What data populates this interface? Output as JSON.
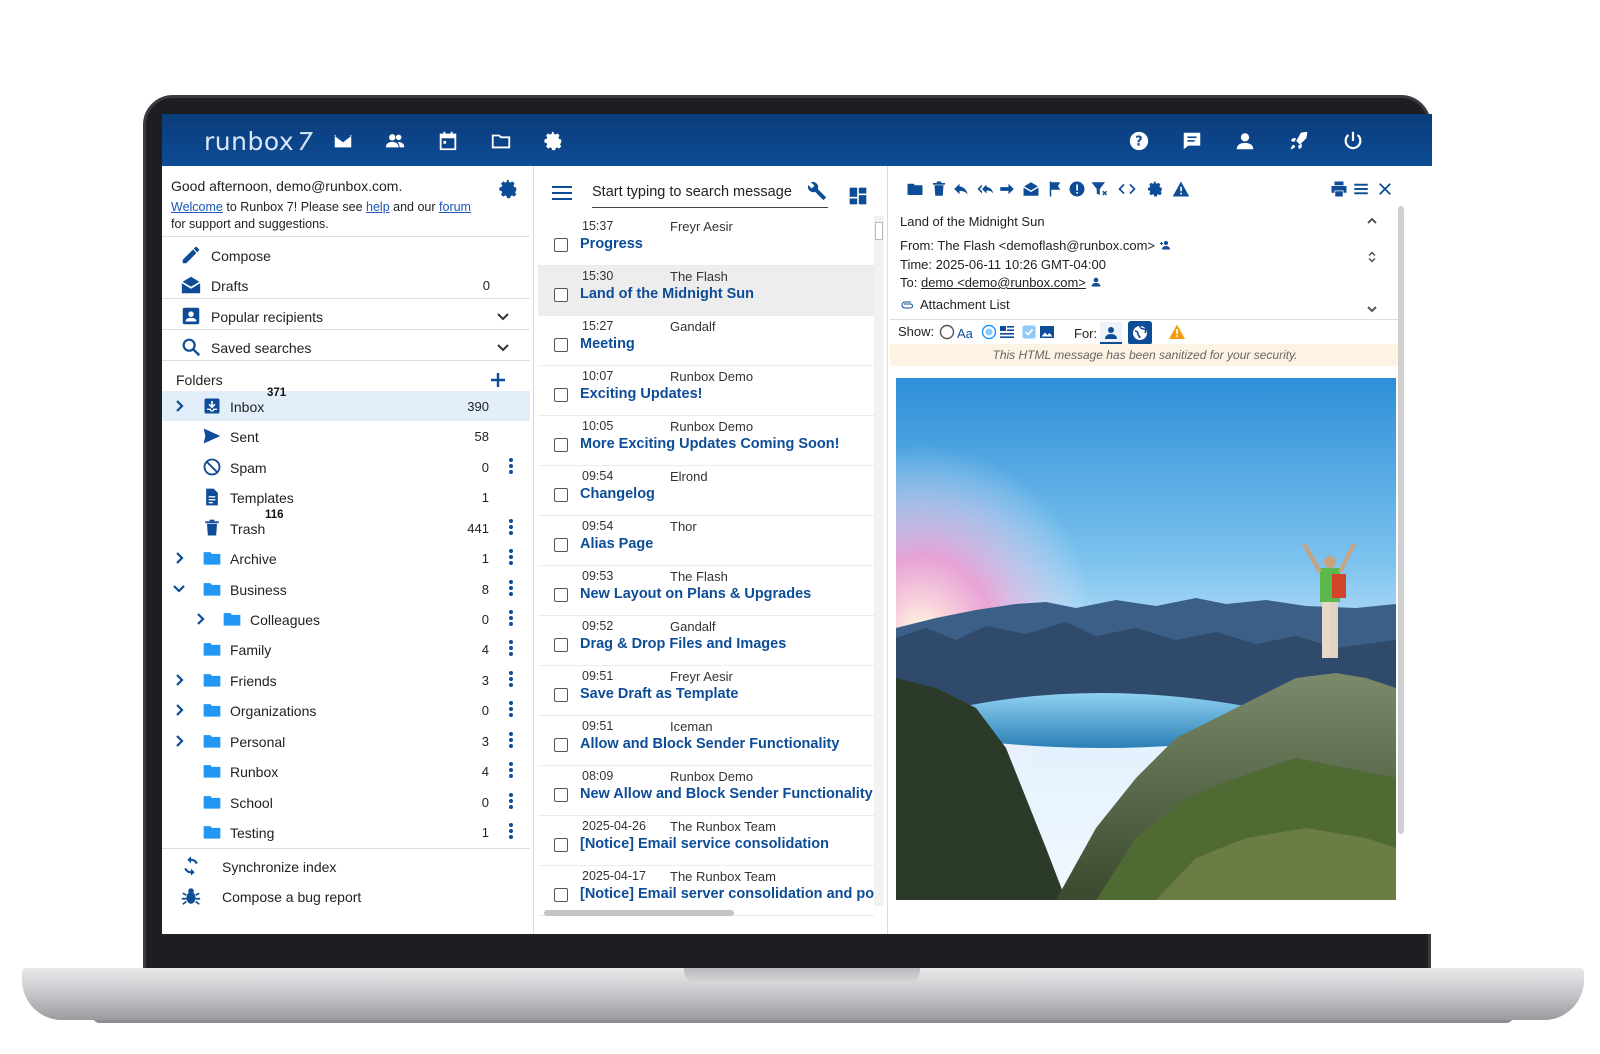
{
  "app": {
    "logo_text": "runbox",
    "logo_version": "7"
  },
  "topbar": {
    "icons_left": [
      "mail-icon",
      "contacts-icon",
      "calendar-icon",
      "folder-icon",
      "settings-icon"
    ],
    "icons_right": [
      "help-icon",
      "feedback-icon",
      "account-icon",
      "rocket-icon",
      "power-icon"
    ]
  },
  "sidebar": {
    "greeting": "Good afternoon, demo@runbox.com.",
    "welcome_link": "Welcome",
    "welcome_text_1": " to Runbox 7! Please see ",
    "help_link": "help",
    "welcome_text_2": " and our ",
    "forum_link": "forum",
    "welcome_text_3": "for support and suggestions.",
    "compose": "Compose",
    "drafts": "Drafts",
    "drafts_count": "0",
    "popular_recipients": "Popular recipients",
    "saved_searches": "Saved searches",
    "folders_header": "Folders",
    "folders": [
      {
        "name": "Inbox",
        "count": "390",
        "badge": "371"
      },
      {
        "name": "Sent",
        "count": "58"
      },
      {
        "name": "Spam",
        "count": "0"
      },
      {
        "name": "Templates",
        "count": "1"
      },
      {
        "name": "Trash",
        "count": "441",
        "badge": "116"
      },
      {
        "name": "Archive",
        "count": "1"
      },
      {
        "name": "Business",
        "count": "8"
      },
      {
        "name": "Colleagues",
        "count": "0"
      },
      {
        "name": "Family",
        "count": "4"
      },
      {
        "name": "Friends",
        "count": "3"
      },
      {
        "name": "Organizations",
        "count": "0"
      },
      {
        "name": "Personal",
        "count": "3"
      },
      {
        "name": "Runbox",
        "count": "4"
      },
      {
        "name": "School",
        "count": "0"
      },
      {
        "name": "Testing",
        "count": "1"
      }
    ],
    "sync_index": "Synchronize index",
    "bug_report": "Compose a bug report"
  },
  "search": {
    "placeholder": "Start typing to search messages"
  },
  "messages": [
    {
      "time": "15:37",
      "from": "Freyr Aesir",
      "subject": "Progress"
    },
    {
      "time": "15:30",
      "from": "The Flash",
      "subject": "Land of the Midnight Sun"
    },
    {
      "time": "15:27",
      "from": "Gandalf",
      "subject": "Meeting"
    },
    {
      "time": "10:07",
      "from": "Runbox Demo",
      "subject": "Exciting Updates!"
    },
    {
      "time": "10:05",
      "from": "Runbox Demo",
      "subject": "More Exciting Updates Coming Soon!"
    },
    {
      "time": "09:54",
      "from": "Elrond",
      "subject": "Changelog"
    },
    {
      "time": "09:54",
      "from": "Thor",
      "subject": "Alias Page"
    },
    {
      "time": "09:53",
      "from": "The Flash",
      "subject": "New Layout on Plans & Upgrades"
    },
    {
      "time": "09:52",
      "from": "Gandalf",
      "subject": "Drag & Drop Files and Images"
    },
    {
      "time": "09:51",
      "from": "Freyr Aesir",
      "subject": "Save Draft as Template"
    },
    {
      "time": "09:51",
      "from": "Iceman",
      "subject": "Allow and Block Sender Functionality"
    },
    {
      "time": "08:09",
      "from": "Runbox Demo",
      "subject": "New Allow and Block Sender Functionality"
    },
    {
      "time": "2025-04-26",
      "from": "The Runbox Team",
      "subject": "[Notice] Email service consolidation"
    },
    {
      "time": "2025-04-17",
      "from": "The Runbox Team",
      "subject": "[Notice] Email server consolidation and post"
    }
  ],
  "reader": {
    "subject": "Land of the Midnight Sun",
    "from": "From: The Flash <demoflash@runbox.com>",
    "time": "Time: 2025-06-11 10:26 GMT-04:00",
    "to_label": "To: ",
    "to_value": "demo <demo@runbox.com>",
    "attachment_list": "Attachment List",
    "show_label": "Show:",
    "show_text_option": "Aa",
    "for_label": "For:",
    "sanitize_notice": "This HTML message has been sanitized for your security."
  },
  "colors": {
    "brand": "#0d4c96",
    "folder": "#2196f3",
    "selected_row": "#e3eefb",
    "warning": "#f39c12"
  }
}
